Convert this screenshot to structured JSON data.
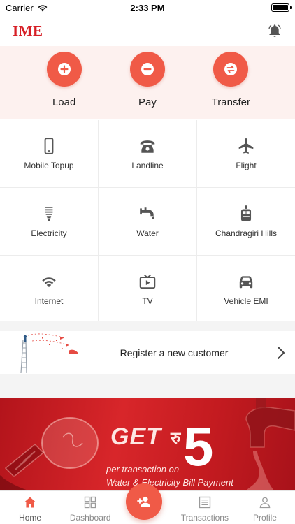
{
  "status_bar": {
    "carrier": "Carrier",
    "time": "2:33 PM",
    "battery_level": 1.0
  },
  "header": {
    "logo": "IME",
    "notification_icon": "bell-icon"
  },
  "quick_actions": [
    {
      "label": "Load",
      "icon": "plus-icon"
    },
    {
      "label": "Pay",
      "icon": "minus-icon"
    },
    {
      "label": "Transfer",
      "icon": "swap-arrows-icon"
    }
  ],
  "services": [
    {
      "label": "Mobile Topup",
      "icon": "mobile-phone-icon"
    },
    {
      "label": "Landline",
      "icon": "telephone-icon"
    },
    {
      "label": "Flight",
      "icon": "airplane-icon"
    },
    {
      "label": "Electricity",
      "icon": "light-bulb-icon"
    },
    {
      "label": "Water",
      "icon": "water-tap-icon"
    },
    {
      "label": "Chandragiri Hills",
      "icon": "cable-car-icon"
    },
    {
      "label": "Internet",
      "icon": "wifi-icon"
    },
    {
      "label": "TV",
      "icon": "tv-icon"
    },
    {
      "label": "Vehicle EMI",
      "icon": "car-icon"
    }
  ],
  "register_banner": {
    "label": "Register a new customer",
    "icon": "chevron-right-icon"
  },
  "promo": {
    "get_text": "GET",
    "currency_symbol": "रु",
    "amount": "5",
    "line1": "per transaction on",
    "line2": "Water & Electricity Bill Payment"
  },
  "bottom_nav": [
    {
      "label": "Home",
      "icon": "home-icon",
      "active": true
    },
    {
      "label": "Dashboard",
      "icon": "dashboard-grid-icon",
      "active": false
    },
    {
      "label": "Transactions",
      "icon": "transactions-list-icon",
      "active": false
    },
    {
      "label": "Profile",
      "icon": "user-profile-icon",
      "active": false
    }
  ],
  "fab_icon": "add-user-icon",
  "colors": {
    "brand_red": "#d71f26",
    "accent_coral": "#f05a47",
    "quick_actions_bg": "#fdf1ef",
    "icon_grey": "#555555"
  }
}
